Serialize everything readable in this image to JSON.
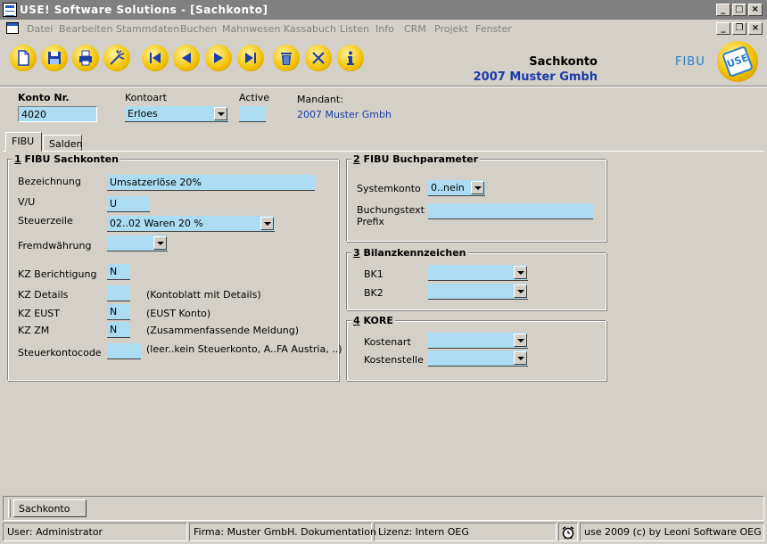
{
  "window": {
    "title": "USE! Software Solutions - [Sachkonto]"
  },
  "menu": [
    "Datei",
    "Bearbeiten",
    "Stammdaten",
    "Buchen",
    "Mahnwesen",
    "Kassabuch",
    "Listen",
    "Info",
    "CRM",
    "Projekt",
    "Fenster"
  ],
  "toolbar": {
    "buttons": [
      "new-icon",
      "save-icon",
      "print-icon",
      "clear-icon",
      "first-icon",
      "previous-icon",
      "next-icon",
      "last-icon",
      "delete-icon",
      "cancel-icon",
      "info-icon"
    ]
  },
  "header": {
    "title": "Sachkonto",
    "company": "2007 Muster Gmbh",
    "module": "FIBU",
    "logo_text": "USE"
  },
  "top_fields": {
    "konto_label": "Konto Nr.",
    "konto_value": "4020",
    "kontoart_label": "Kontoart",
    "kontoart_value": "Erloes",
    "active_label": "Active",
    "active_value": "",
    "mandant_label": "Mandant:",
    "mandant_value": "2007 Muster Gmbh"
  },
  "tabs": [
    "FIBU",
    "Salden"
  ],
  "fibu_sachkonten": {
    "legend_num": "1",
    "legend": "FIBU Sachkonten",
    "bezeichnung_label": "Bezeichnung",
    "bezeichnung_value": "Umsatzerlöse 20%",
    "vu_label": "V/U",
    "vu_value": "U",
    "steuerzeile_label": "Steuerzeile",
    "steuerzeile_value": "02..02 Waren 20 %",
    "fremdwaehrung_label": "Fremdwährung",
    "fremdwaehrung_value": "",
    "kz_berichtigung_label": "KZ Berichtigung",
    "kz_berichtigung_value": "N",
    "kz_details_label": "KZ Details",
    "kz_details_value": "",
    "kz_details_hint": "(Kontoblatt mit Details)",
    "kz_eust_label": "KZ EUST",
    "kz_eust_value": "N",
    "kz_eust_hint": "(EUST Konto)",
    "kz_zm_label": "KZ ZM",
    "kz_zm_value": "N",
    "kz_zm_hint": "(Zusammenfassende Meldung)",
    "steuerkontocode_label": "Steuerkontocode",
    "steuerkontocode_value": "",
    "steuerkontocode_hint": "(leer..kein Steuerkonto, A..FA Austria, ..)"
  },
  "fibu_buchparameter": {
    "legend_num": "2",
    "legend": "FIBU Buchparameter",
    "systemkonto_label": "Systemkonto",
    "systemkonto_value": "0..nein",
    "buchungstext_label": "Buchungstext",
    "prefix_label": "Prefix",
    "buchungstext_value": ""
  },
  "bilanzkennzeichen": {
    "legend_num": "3",
    "legend": "Bilanzkennzeichen",
    "bk1_label": "BK1",
    "bk1_value": "",
    "bk2_label": "BK2",
    "bk2_value": ""
  },
  "kore": {
    "legend_num": "4",
    "legend": "KORE",
    "kostenart_label": "Kostenart",
    "kostenart_value": "",
    "kostenstelle_label": "Kostenstelle",
    "kostenstelle_value": ""
  },
  "taskbar": {
    "window_tab": "Sachkonto"
  },
  "statusbar": {
    "user": "User: Administrator",
    "firma": "Firma: Muster GmbH. Dokumentation",
    "lizenz": "Lizenz: Intern OEG",
    "copyright": "use 2009 (c) by Leoni Software OEG"
  },
  "colors": {
    "field_bg": "#acdcf2",
    "company_blue": "#1a3aa8",
    "title_bar": "#808080",
    "window_bg": "#d4d0c8"
  }
}
